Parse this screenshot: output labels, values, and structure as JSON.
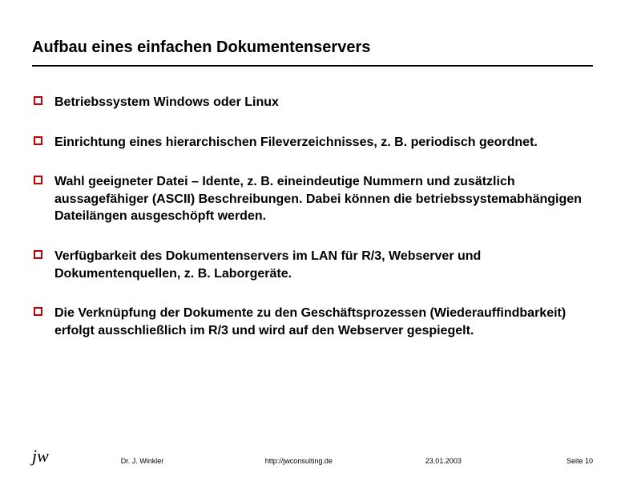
{
  "title": "Aufbau eines einfachen Dokumentenservers",
  "bullets": {
    "items": [
      {
        "text": "Betriebssystem Windows oder Linux"
      },
      {
        "text": "Einrichtung eines hierarchischen Fileverzeichnisses, z. B. periodisch geordnet."
      },
      {
        "text": "Wahl geeigneter Datei – Idente, z. B. eineindeutige Nummern und zusätzlich aussagefähiger (ASCII) Beschreibungen. Dabei können die betriebssystemabhängigen Dateilängen ausgeschöpft werden."
      },
      {
        "text": "Verfügbarkeit des Dokumentenservers im LAN für R/3, Webserver und Dokumentenquellen, z. B. Laborgeräte."
      },
      {
        "text": "Die Verknüpfung der Dokumente zu den Geschäftsprozessen (Wiederauffindbarkeit) erfolgt ausschließlich im R/3 und wird auf den Webserver gespiegelt."
      }
    ]
  },
  "footer": {
    "logo": "jw",
    "author": "Dr. J. Winkler",
    "url": "http://jwconsulting.de",
    "date": "23.01.2003",
    "page": "Seite 10"
  },
  "colors": {
    "accent": "#c00000"
  }
}
